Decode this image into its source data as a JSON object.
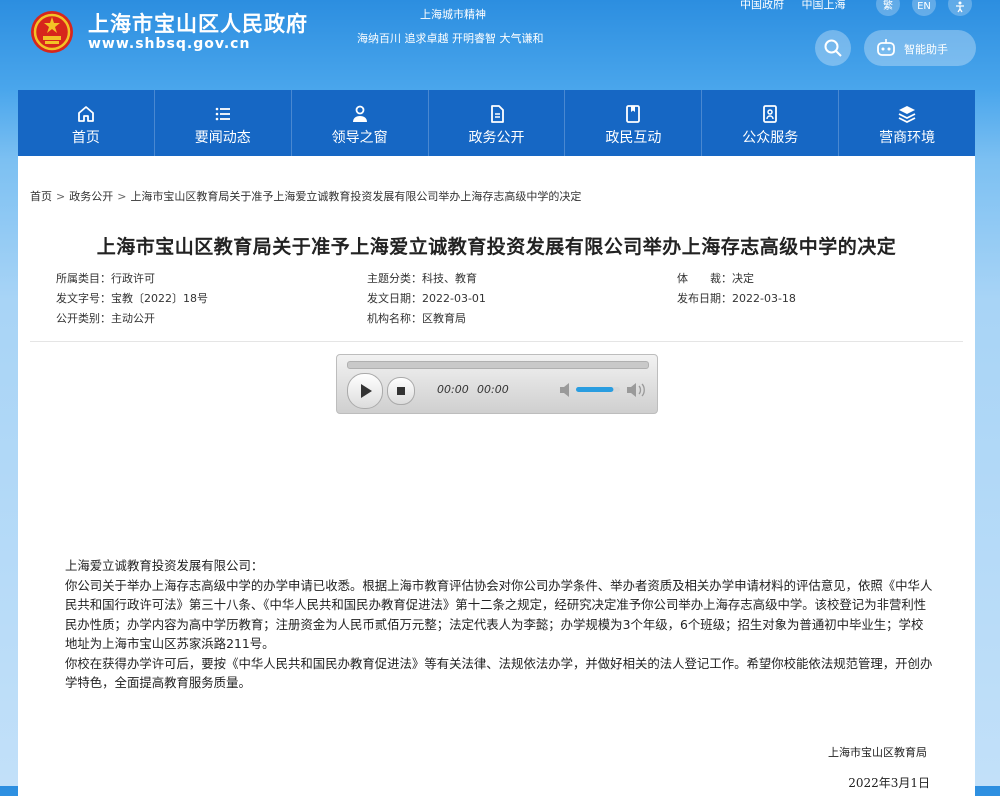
{
  "header": {
    "site_title": "上海市宝山区人民政府",
    "site_domain": "www.shbsq.gov.cn",
    "spirit_title": "上海城市精神",
    "spirit_text": "海纳百川 追求卓越 开明睿智 大气谦和",
    "top_links": [
      "中国政府",
      "中国上海"
    ],
    "lang_buttons": [
      "繁",
      "EN"
    ],
    "assistant_label": "智能助手"
  },
  "nav": {
    "items": [
      {
        "label": "首页",
        "icon": "home-icon"
      },
      {
        "label": "要闻动态",
        "icon": "list-icon"
      },
      {
        "label": "领导之窗",
        "icon": "person-icon"
      },
      {
        "label": "政务公开",
        "icon": "document-icon"
      },
      {
        "label": "政民互动",
        "icon": "bookmark-icon"
      },
      {
        "label": "公众服务",
        "icon": "service-icon"
      },
      {
        "label": "营商环境",
        "icon": "layers-icon"
      }
    ]
  },
  "breadcrumb": [
    "首页",
    "政务公开",
    "上海市宝山区教育局关于准予上海爱立诚教育投资发展有限公司举办上海存志高级中学的决定"
  ],
  "document": {
    "title": "上海市宝山区教育局关于准予上海爱立诚教育投资发展有限公司举办上海存志高级中学的决定",
    "meta": {
      "category": "所属类目：行政许可",
      "doc_number": "发文字号：宝教〔2022〕18号",
      "disclosure": "公开类别：主动公开",
      "topic": "主题分类：科技、教育",
      "issue_date": "发文日期：2022-03-01",
      "agency": "机构名称：区教育局",
      "genre": "体　　裁：决定",
      "publish_date": "发布日期：2022-03-18"
    },
    "player": {
      "current_time": "00:00",
      "duration": "00:00",
      "volume": 0.85
    },
    "salutation": "上海爱立诚教育投资发展有限公司：",
    "paragraph1": "你公司关于举办上海存志高级中学的办学申请已收悉。根据上海市教育评估协会对你公司办学条件、举办者资质及相关办学申请材料的评估意见，依照《中华人民共和国行政许可法》第三十八条、《中华人民共和国民办教育促进法》第十二条之规定，经研究决定准予你公司举办上海存志高级中学。该校登记为非营利性民办性质；办学内容为高中学历教育；注册资金为人民币贰佰万元整；法定代表人为李懿；办学规模为3个年级，6个班级；招生对象为普通初中毕业生；学校地址为上海市宝山区苏家浜路211号。",
    "paragraph2": "你校在获得办学许可后，要按《中华人民共和国民办教育促进法》等有关法律、法规依法办学，并做好相关的法人登记工作。希望你校能依法规范管理，开创办学特色，全面提高教育服务质量。",
    "signer": "上海市宝山区教育局",
    "sign_date": "2022年3月1日"
  },
  "colors": {
    "nav_bg": "#1667c4",
    "header_top": "#2c8ee0",
    "emblem_red": "#d7261c",
    "emblem_gold": "#f3c226"
  }
}
